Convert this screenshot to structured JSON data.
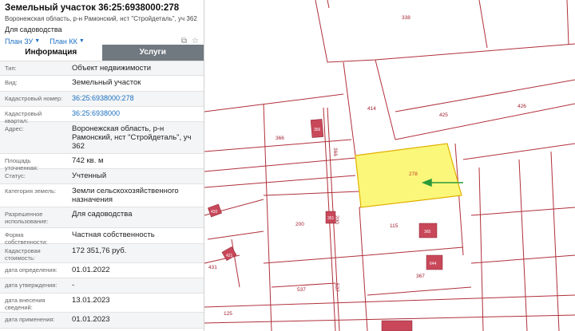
{
  "header": {
    "title": "Земельный участок 36:25:6938000:278",
    "address": "Воронежская область, р-н Рамонский, нст \"Стройдеталь\", уч 362",
    "use": "Для садоводства",
    "link_zu": "План ЗУ",
    "link_kk": "План КК"
  },
  "tabs": {
    "info": "Информация",
    "services": "Услуги"
  },
  "rows": [
    {
      "k": "Тип:",
      "v": "Объект недвижимости"
    },
    {
      "k": "Вид:",
      "v": "Земельный участок"
    },
    {
      "k": "Кадастровый номер:",
      "v": "36:25:6938000:278"
    },
    {
      "k": "Кадастровый квартал:",
      "v": "36:25:6938000"
    },
    {
      "k": "Адрес:",
      "v": "Воронежская область, р-н Рамонский, нст \"Стройдеталь\", уч 362"
    },
    {
      "k": "Площадь уточненная:",
      "v": "742 кв. м"
    },
    {
      "k": "Статус:",
      "v": "Учтенный"
    },
    {
      "k": "Категория земель:",
      "v": "Земли сельскохозяйственного назначения"
    },
    {
      "k": "Разрешенное использование:",
      "v": "Для садоводства"
    },
    {
      "k": "Форма собственности:",
      "v": "Частная собственность"
    },
    {
      "k": "Кадастровая стоимость:",
      "v": "172 351,76 руб."
    },
    {
      "k": "дата определения:",
      "v": "01.01.2022"
    },
    {
      "k": "дата утверждения:",
      "v": "-"
    },
    {
      "k": "дата внесения сведений:",
      "v": "13.01.2023"
    },
    {
      "k": "дата применения:",
      "v": "01.01.2023"
    }
  ],
  "map": {
    "labels": [
      "338",
      "414",
      "425",
      "426",
      "366",
      "366",
      "278",
      "200",
      "200",
      "115",
      "431",
      "537",
      "537",
      "367",
      "125"
    ],
    "building_labels": [
      "356",
      "361",
      "365",
      "420",
      "644",
      "421"
    ],
    "colors": {
      "boundary": "#b0303a",
      "selected_fill": "#fbf77a",
      "selected_stroke": "#e0b000",
      "building": "#c8485a",
      "arrow": "#2a9a3a",
      "link": "#1a6fc0"
    }
  }
}
